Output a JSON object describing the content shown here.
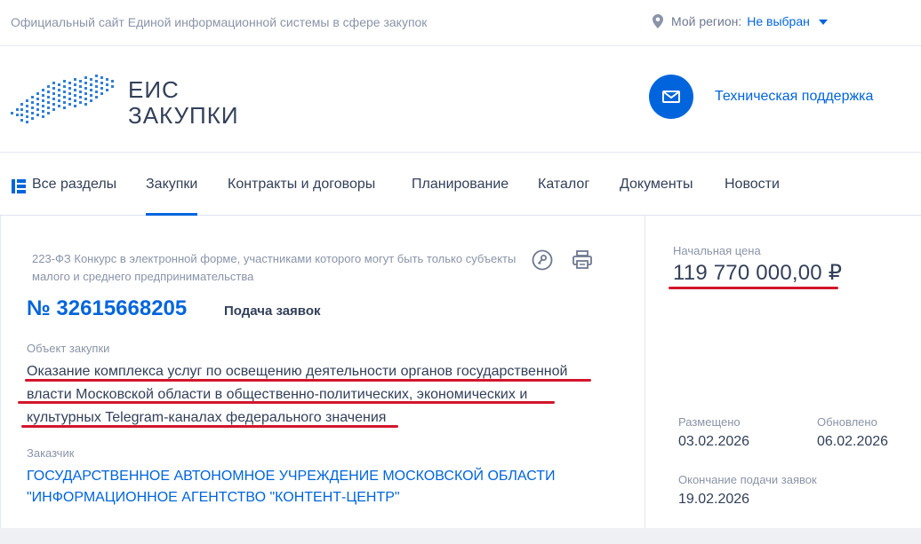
{
  "topbar": {
    "site_description": "Официальный сайт Единой информационной системы в сфере закупок",
    "region_label": "Мой регион:",
    "region_value": "Не выбран"
  },
  "logo": {
    "line1": "ЕИС",
    "line2": "ЗАКУПКИ"
  },
  "support": {
    "label": "Техническая поддержка"
  },
  "nav": {
    "items": [
      {
        "label": "Все разделы"
      },
      {
        "label": "Закупки"
      },
      {
        "label": "Контракты и договоры"
      },
      {
        "label": "Планирование"
      },
      {
        "label": "Каталог"
      },
      {
        "label": "Документы"
      },
      {
        "label": "Новости"
      }
    ],
    "active": "Закупки"
  },
  "procurement": {
    "type": "223-ФЗ Конкурс в электронной форме, участниками которого могут быть только субъекты малого и среднего предпринимательства",
    "number": "№ 32615668205",
    "status": "Подача заявок",
    "object_label": "Объект закупки",
    "object_lines": [
      "Оказание комплекса услуг по освещению деятельности органов государственной",
      "власти Московской области в общественно-политических, экономических и",
      "культурных Telegram-каналах федерального значения"
    ],
    "customer_label": "Заказчик",
    "customer_lines": [
      "ГОСУДАРСТВЕННОЕ АВТОНОМНОЕ УЧРЕЖДЕНИЕ МОСКОВСКОЙ ОБЛАСТИ",
      "\"ИНФОРМАЦИОННОЕ АГЕНТСТВО \"КОНТЕНТ-ЦЕНТР\""
    ]
  },
  "sidebar": {
    "price_label": "Начальная цена",
    "price_value": "119 770 000,00 ₽",
    "published_label": "Размещено",
    "published_value": "03.02.2026",
    "updated_label": "Обновлено",
    "updated_value": "06.02.2026",
    "deadline_label": "Окончание подачи заявок",
    "deadline_value": "19.02.2026"
  },
  "colors": {
    "accent": "#0065dd",
    "text": "#334059",
    "muted": "#8a94a8",
    "highlight_underline": "#d3162c"
  },
  "icons": [
    "location-pin-icon",
    "caret-down-icon",
    "russia-map-logo",
    "envelope-icon",
    "grid-menu-icon",
    "key-icon",
    "printer-icon"
  ]
}
